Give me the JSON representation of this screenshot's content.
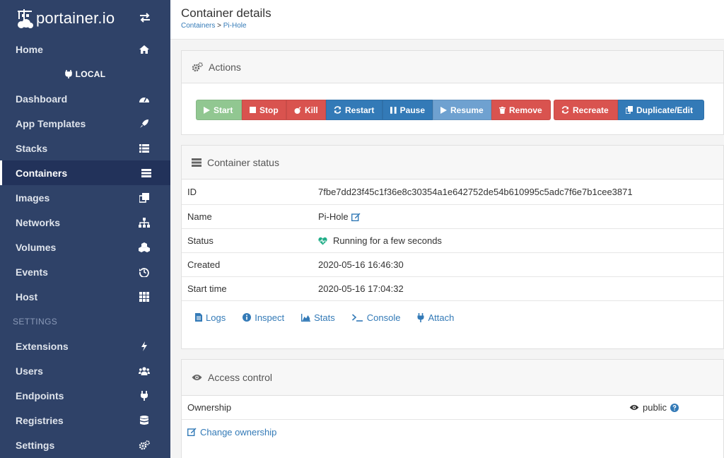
{
  "brand": {
    "name": "portainer.io"
  },
  "sidebar": {
    "home": "Home",
    "environment": "LOCAL",
    "items": [
      {
        "label": "Dashboard",
        "icon": "tachometer-icon"
      },
      {
        "label": "App Templates",
        "icon": "rocket-icon"
      },
      {
        "label": "Stacks",
        "icon": "th-list-icon"
      },
      {
        "label": "Containers",
        "icon": "server-icon",
        "active": true
      },
      {
        "label": "Images",
        "icon": "clone-icon"
      },
      {
        "label": "Networks",
        "icon": "sitemap-icon"
      },
      {
        "label": "Volumes",
        "icon": "cubes-icon"
      },
      {
        "label": "Events",
        "icon": "history-icon"
      },
      {
        "label": "Host",
        "icon": "th-icon"
      }
    ],
    "settings_label": "SETTINGS",
    "settings_items": [
      {
        "label": "Extensions",
        "icon": "bolt-icon"
      },
      {
        "label": "Users",
        "icon": "users-icon"
      },
      {
        "label": "Endpoints",
        "icon": "plug-icon"
      },
      {
        "label": "Registries",
        "icon": "database-icon"
      },
      {
        "label": "Settings",
        "icon": "cogs-icon"
      }
    ]
  },
  "header": {
    "title": "Container details",
    "breadcrumb": {
      "parent": "Containers",
      "separator": " > ",
      "current": "Pi-Hole"
    }
  },
  "actions": {
    "title": "Actions",
    "buttons": {
      "start": "Start",
      "stop": "Stop",
      "kill": "Kill",
      "restart": "Restart",
      "pause": "Pause",
      "resume": "Resume",
      "remove": "Remove",
      "recreate": "Recreate",
      "duplicate": "Duplicate/Edit"
    },
    "colors": {
      "success": "#5cb85c",
      "danger": "#d9534f",
      "primary": "#337ab7",
      "primary_light": "#6fa1d0"
    }
  },
  "status": {
    "title": "Container status",
    "rows": {
      "id": {
        "label": "ID",
        "value": "7fbe7dd23f45c1f36e8c30354a1e642752de54b610995c5adc7f6e7b1cee3871"
      },
      "name": {
        "label": "Name",
        "value": "Pi-Hole"
      },
      "status": {
        "label": "Status",
        "value": "Running for a few seconds"
      },
      "created": {
        "label": "Created",
        "value": "2020-05-16 16:46:30"
      },
      "start_time": {
        "label": "Start time",
        "value": "2020-05-16 17:04:32"
      }
    },
    "links": {
      "logs": "Logs",
      "inspect": "Inspect",
      "stats": "Stats",
      "console": "Console",
      "attach": "Attach"
    },
    "heartbeat_color": "#23ae89"
  },
  "access": {
    "title": "Access control",
    "ownership_label": "Ownership",
    "ownership_value": "public",
    "change_label": "Change ownership"
  }
}
